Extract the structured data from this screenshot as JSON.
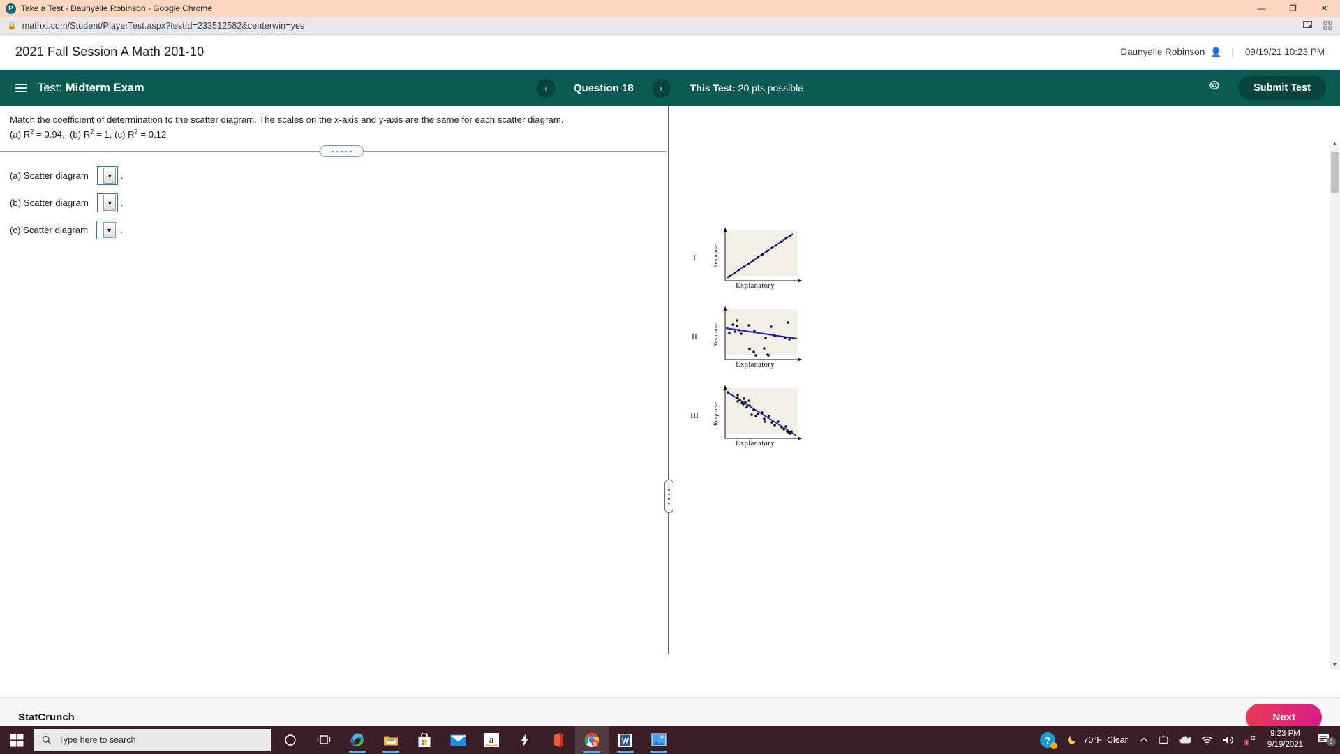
{
  "browser": {
    "tab_title": "Take a Test - Daunyelle Robinson - Google Chrome",
    "favicon_letter": "P",
    "url": "mathxl.com/Student/PlayerTest.aspx?testId=233512582&centerwin=yes",
    "lock_icon": "lock-icon",
    "window_controls": {
      "minimize": "—",
      "maximize": "❐",
      "close": "✕"
    }
  },
  "course_header": {
    "title": "2021 Fall Session A Math 201-10",
    "user_name": "Daunyelle Robinson",
    "user_icon": "person-icon",
    "separator": "|",
    "timestamp": "09/19/21 10:23 PM"
  },
  "navbar": {
    "menu_icon": "hamburger-menu-icon",
    "test_label": "Test:",
    "test_name": "Midterm Exam",
    "prev_arrow": "‹",
    "next_arrow": "›",
    "question_label": "Question 18",
    "this_test_label": "This Test:",
    "this_test_points": "20 pts possible",
    "settings_icon": "gear-icon",
    "submit_label": "Submit Test",
    "bar_color": "#0a5c52",
    "submit_color": "#08443d"
  },
  "question": {
    "prompt": "Match the coefficient of determination to the scatter diagram. The scales on the x-axis and y-axis are the same for each scatter diagram.",
    "choices_line_prefix": "(a) R",
    "choices": [
      {
        "key": "(a)",
        "symbol": "R",
        "exponent": "2",
        "equals": "=",
        "value": "0.94"
      },
      {
        "key": "(b)",
        "symbol": "R",
        "exponent": "2",
        "equals": "=",
        "value": "1"
      },
      {
        "key": "(c)",
        "symbol": "R",
        "exponent": "2",
        "equals": "=",
        "value": "0.12"
      }
    ]
  },
  "answers": {
    "rows": [
      {
        "label": "(a) Scatter diagram",
        "value": "",
        "trailing": "."
      },
      {
        "label": "(b) Scatter diagram",
        "value": "",
        "trailing": "."
      },
      {
        "label": "(c) Scatter diagram",
        "value": "",
        "trailing": "."
      }
    ],
    "dropdown_arrow": "▼"
  },
  "figures": [
    {
      "roman": "I",
      "x_caption": "Explanatory",
      "y_caption": "Response"
    },
    {
      "roman": "II",
      "x_caption": "Explanatory",
      "y_caption": "Response"
    },
    {
      "roman": "III",
      "x_caption": "Explanatory",
      "y_caption": "Response"
    }
  ],
  "chart_data": [
    {
      "type": "scatter",
      "label": "I",
      "title": "",
      "xlabel": "Explanatory",
      "ylabel": "Response",
      "xlim": [
        0,
        100
      ],
      "ylim": [
        0,
        100
      ],
      "grid": false,
      "trendline": {
        "slope": 0.92,
        "intercept": 4,
        "color": "#1f1fc8"
      },
      "description": "Perfect positive linear relationship, points lie exactly on the line",
      "points": [
        [
          5,
          9
        ],
        [
          12,
          15
        ],
        [
          19,
          22
        ],
        [
          26,
          28
        ],
        [
          33,
          34
        ],
        [
          40,
          41
        ],
        [
          47,
          47
        ],
        [
          54,
          54
        ],
        [
          61,
          60
        ],
        [
          68,
          66
        ],
        [
          75,
          73
        ],
        [
          82,
          79
        ],
        [
          89,
          86
        ],
        [
          95,
          92
        ]
      ]
    },
    {
      "type": "scatter",
      "label": "II",
      "title": "",
      "xlabel": "Explanatory",
      "ylabel": "Response",
      "xlim": [
        0,
        100
      ],
      "ylim": [
        0,
        100
      ],
      "grid": false,
      "trendline": {
        "slope": -0.22,
        "intercept": 72,
        "color": "#1f1fc8"
      },
      "description": "Weak negative linear relationship, widely scattered points",
      "points": [
        [
          6,
          60
        ],
        [
          11,
          78
        ],
        [
          14,
          63
        ],
        [
          17,
          86
        ],
        [
          17,
          74
        ],
        [
          20,
          66
        ],
        [
          22,
          59
        ],
        [
          33,
          76
        ],
        [
          34,
          24
        ],
        [
          40,
          18
        ],
        [
          41,
          65
        ],
        [
          43,
          9
        ],
        [
          55,
          26
        ],
        [
          57,
          48
        ],
        [
          60,
          10
        ],
        [
          61,
          8
        ],
        [
          65,
          72
        ],
        [
          70,
          53
        ],
        [
          84,
          48
        ],
        [
          88,
          83
        ],
        [
          90,
          45
        ]
      ]
    },
    {
      "type": "scatter",
      "label": "III",
      "title": "",
      "xlabel": "Explanatory",
      "ylabel": "Response",
      "xlim": [
        0,
        100
      ],
      "ylim": [
        0,
        100
      ],
      "grid": false,
      "trendline": {
        "slope": -0.92,
        "intercept": 92,
        "color": "#1f1fc8"
      },
      "description": "Strong negative linear relationship, points tightly clustered about the line",
      "points": [
        [
          3,
          90
        ],
        [
          17,
          86
        ],
        [
          17,
          80
        ],
        [
          17,
          72
        ],
        [
          20,
          75
        ],
        [
          23,
          68
        ],
        [
          25,
          65
        ],
        [
          26,
          78
        ],
        [
          28,
          70
        ],
        [
          30,
          60
        ],
        [
          33,
          73
        ],
        [
          34,
          63
        ],
        [
          37,
          45
        ],
        [
          40,
          55
        ],
        [
          43,
          42
        ],
        [
          46,
          47
        ],
        [
          52,
          50
        ],
        [
          55,
          36
        ],
        [
          56,
          30
        ],
        [
          62,
          42
        ],
        [
          66,
          28
        ],
        [
          70,
          22
        ],
        [
          75,
          30
        ],
        [
          80,
          18
        ],
        [
          83,
          14
        ],
        [
          86,
          20
        ],
        [
          88,
          10
        ],
        [
          90,
          8
        ],
        [
          92,
          6
        ],
        [
          94,
          10
        ]
      ]
    }
  ],
  "splitter": {
    "horizontal_handle": "drag-handle-horizontal",
    "vertical_handle": "drag-handle-vertical"
  },
  "bottom_bar": {
    "statcrunch_label": "StatCrunch",
    "next_label": "Next",
    "next_color": "#e0226c"
  },
  "taskbar": {
    "start_icon": "windows-start-icon",
    "search_placeholder": "Type here to search",
    "search_icon": "search-icon",
    "icons": [
      {
        "name": "cortana-icon",
        "glyph": "○",
        "running": false
      },
      {
        "name": "task-view-icon",
        "glyph": "",
        "running": false
      },
      {
        "name": "microsoft-edge-icon",
        "glyph": "",
        "running": true
      },
      {
        "name": "file-explorer-icon",
        "glyph": "",
        "running": true
      },
      {
        "name": "microsoft-store-icon",
        "glyph": "",
        "running": false
      },
      {
        "name": "mail-icon",
        "glyph": "",
        "running": false
      },
      {
        "name": "amazon-icon",
        "glyph": "a",
        "running": false
      },
      {
        "name": "lightning-app-icon",
        "glyph": "",
        "running": false
      },
      {
        "name": "microsoft-office-icon",
        "glyph": "",
        "running": false
      },
      {
        "name": "google-chrome-icon",
        "glyph": "",
        "running": true,
        "active": true
      },
      {
        "name": "microsoft-word-icon",
        "glyph": "W",
        "running": true
      },
      {
        "name": "photos-icon",
        "glyph": "",
        "running": true
      }
    ],
    "tray": {
      "help_icon": "help-question-icon",
      "weather_icon": "moon-icon",
      "weather_temp": "70°F",
      "weather_condition": "Clear",
      "chevron_icon": "chevron-up-icon",
      "screen_icon": "screen-capture-icon",
      "onedrive_icon": "onedrive-cloud-icon",
      "wifi_icon": "wifi-icon",
      "volume_icon": "volume-icon",
      "input_icon": "input-indicator-icon",
      "time": "9:23 PM",
      "date": "9/19/2021",
      "notification_icon": "notifications-icon",
      "notification_count": "3"
    }
  }
}
